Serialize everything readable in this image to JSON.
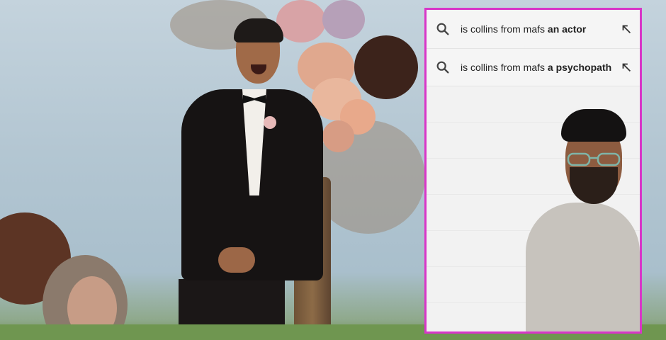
{
  "suggestions": [
    {
      "prefix": "is collins from mafs ",
      "bold": "an actor",
      "icons": {
        "search": "search-icon",
        "fill": "arrow-up-left-icon"
      }
    },
    {
      "prefix": "is collins from mafs ",
      "bold": "a psychopath",
      "icons": {
        "search": "search-icon",
        "fill": "arrow-up-left-icon"
      }
    }
  ],
  "colors": {
    "overlay_border": "#d836c8",
    "suggestion_bg": "#f5f5f5",
    "text": "#222222"
  }
}
